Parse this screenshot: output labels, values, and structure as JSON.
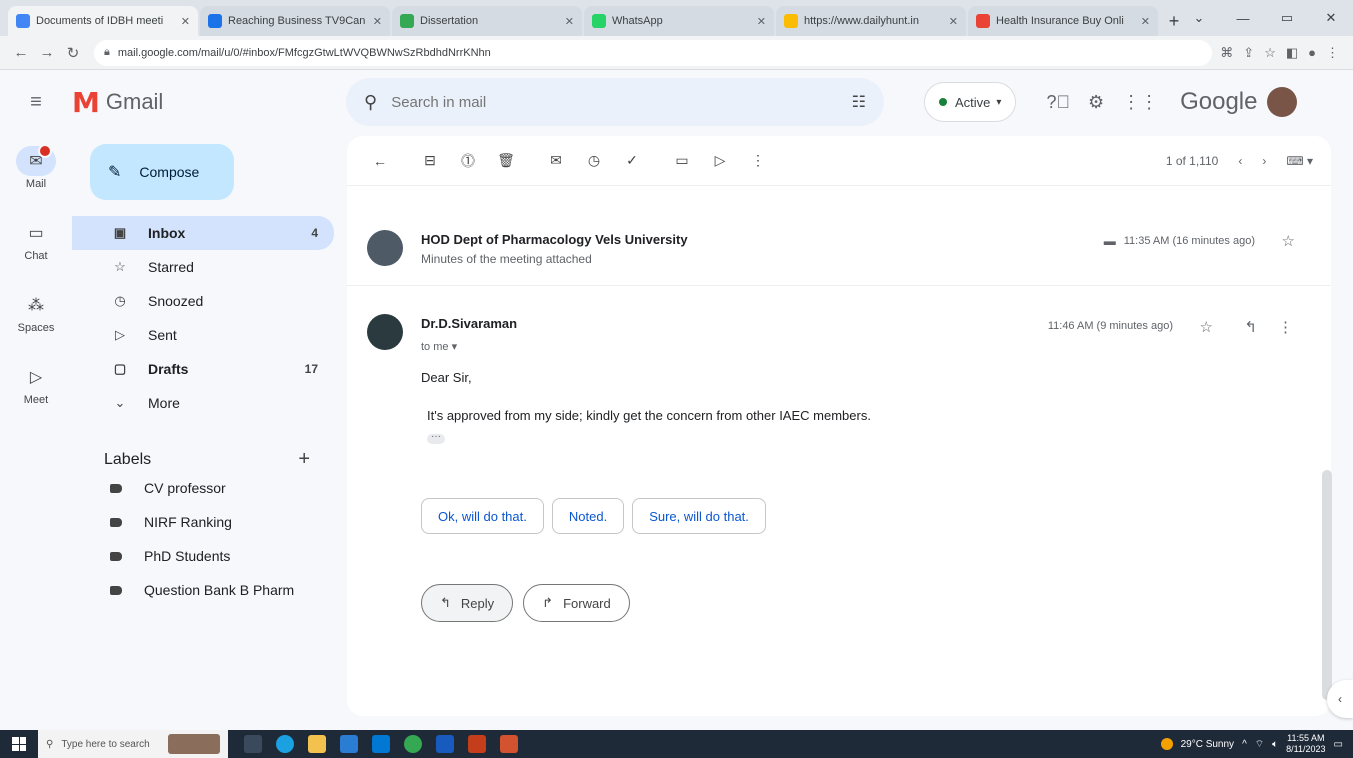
{
  "browser": {
    "tabs": [
      {
        "title": "Documents of IDBH meeti",
        "color": "#4285f4",
        "active": true
      },
      {
        "title": "Reaching Business TV9Can",
        "color": "#1a73e8",
        "active": false
      },
      {
        "title": "Dissertation",
        "color": "#34a853",
        "active": false
      },
      {
        "title": "WhatsApp",
        "color": "#25d366",
        "active": false
      },
      {
        "title": "https://www.dailyhunt.in",
        "color": "#fbbc04",
        "active": false
      },
      {
        "title": "Health Insurance Buy Onli",
        "color": "#ea4335",
        "active": false
      }
    ],
    "url": "mail.google.com/mail/u/0/#inbox/FMfcgzGtwLtWVQBWNwSzRbdhdNrrKNhn"
  },
  "gmail": {
    "app_name": "Gmail",
    "search_placeholder": "Search in mail",
    "status": "Active",
    "brand": "Google"
  },
  "rail": [
    {
      "label": "Mail",
      "icon": "mail-icon",
      "active": true,
      "badge": true
    },
    {
      "label": "Chat",
      "icon": "chat-icon",
      "active": false,
      "badge": false
    },
    {
      "label": "Spaces",
      "icon": "spaces-icon",
      "active": false,
      "badge": false
    },
    {
      "label": "Meet",
      "icon": "meet-icon",
      "active": false,
      "badge": false
    }
  ],
  "sidebar": {
    "compose": "Compose",
    "items": [
      {
        "label": "Inbox",
        "count": "4",
        "icon": "inbox-icon",
        "glyph": "▣",
        "active": true,
        "bold": true
      },
      {
        "label": "Starred",
        "count": "",
        "icon": "star-icon",
        "glyph": "☆",
        "active": false,
        "bold": false
      },
      {
        "label": "Snoozed",
        "count": "",
        "icon": "clock-icon",
        "glyph": "◷",
        "active": false,
        "bold": false
      },
      {
        "label": "Sent",
        "count": "",
        "icon": "send-icon",
        "glyph": "▷",
        "active": false,
        "bold": false
      },
      {
        "label": "Drafts",
        "count": "17",
        "icon": "draft-icon",
        "glyph": "▢",
        "active": false,
        "bold": true
      },
      {
        "label": "More",
        "count": "",
        "icon": "chevron-down-icon",
        "glyph": "⌄",
        "active": false,
        "bold": false
      }
    ],
    "labels_title": "Labels",
    "labels": [
      "CV professor",
      "NIRF Ranking",
      "PhD Students",
      "Question Bank B Pharm"
    ]
  },
  "toolbar": {
    "counter": "1 of 1,110"
  },
  "thread": {
    "collapsed": {
      "sender": "HOD Dept of Pharmacology Vels University",
      "snippet": "Minutes of the meeting attached",
      "time": "11:35 AM (16 minutes ago)"
    },
    "open": {
      "sender": "Dr.D.Sivaraman",
      "to": "to me",
      "time": "11:46 AM (9 minutes ago)",
      "greeting": "Dear Sir,",
      "body": "It's approved from my side; kindly get the concern from other IAEC members."
    },
    "smart_replies": [
      "Ok, will do that.",
      "Noted.",
      "Sure, will do that."
    ],
    "reply": "Reply",
    "forward": "Forward"
  },
  "taskbar": {
    "search_placeholder": "Type here to search",
    "weather": "29°C Sunny",
    "time": "11:55 AM",
    "date": "8/11/2023"
  }
}
